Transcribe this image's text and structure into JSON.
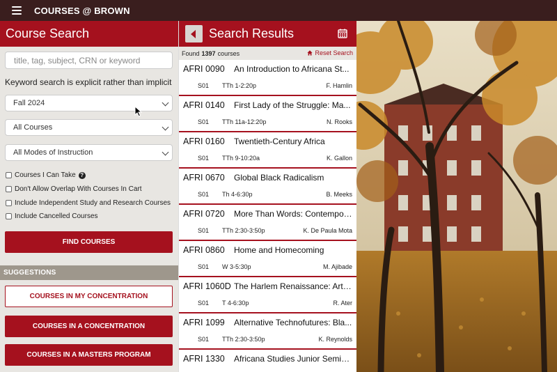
{
  "app": {
    "title": "COURSES @ BROWN"
  },
  "left": {
    "header": "Course Search",
    "search_placeholder": "title, tag, subject, CRN or keyword",
    "explicit_note": "Keyword search is explicit rather than implicit",
    "term": "Fall 2024",
    "course_filter": "All Courses",
    "mode_filter": "All Modes of Instruction",
    "checkboxes": [
      "Courses I Can Take",
      "Don't Allow Overlap With Courses In Cart",
      "Include Independent Study and Research Courses",
      "Include Cancelled Courses"
    ],
    "find_label": "FIND COURSES",
    "suggestions_header": "SUGGESTIONS",
    "suggestions": [
      "COURSES IN MY CONCENTRATION",
      "COURSES IN A CONCENTRATION",
      "COURSES IN A MASTERS PROGRAM"
    ]
  },
  "middle": {
    "header": "Search Results",
    "found_prefix": "Found",
    "found_count": "1397",
    "found_suffix": "courses",
    "reset_label": "Reset Search",
    "results": [
      {
        "code": "AFRI 0090",
        "title": "An Introduction to Africana St...",
        "section": "S01",
        "time": "TTh 1-2:20p",
        "instructor": "F. Hamlin"
      },
      {
        "code": "AFRI 0140",
        "title": "First Lady of the Struggle: Ma...",
        "section": "S01",
        "time": "TTh 11a-12:20p",
        "instructor": "N. Rooks"
      },
      {
        "code": "AFRI 0160",
        "title": "Twentieth-Century Africa",
        "section": "S01",
        "time": "TTh 9-10:20a",
        "instructor": "K. Gallon"
      },
      {
        "code": "AFRI 0670",
        "title": "Global Black Radicalism",
        "section": "S01",
        "time": "Th 4-6:30p",
        "instructor": "B. Meeks"
      },
      {
        "code": "AFRI 0720",
        "title": "More Than Words: Contempor...",
        "section": "S01",
        "time": "TTh 2:30-3:50p",
        "instructor": "K. De Paula Mota"
      },
      {
        "code": "AFRI 0860",
        "title": "Home and Homecoming",
        "section": "S01",
        "time": "W 3-5:30p",
        "instructor": "M. Ajibade"
      },
      {
        "code": "AFRI 1060D",
        "title": "The Harlem Renaissance: Art, ...",
        "section": "S01",
        "time": "T 4-6:30p",
        "instructor": "R. Ater"
      },
      {
        "code": "AFRI 1099",
        "title": "Alternative Technofutures: Bla...",
        "section": "S01",
        "time": "TTh 2:30-3:50p",
        "instructor": "K. Reynolds"
      },
      {
        "code": "AFRI 1330",
        "title": "Africana Studies Junior Seminar",
        "section": "",
        "time": "",
        "instructor": ""
      }
    ]
  },
  "icons": {
    "menu": "hamburger-icon",
    "back": "caret-left-icon",
    "calendar": "calendar-icon",
    "reset": "home-icon",
    "help": "question-circle-icon",
    "dropdown": "chevron-down-icon"
  },
  "colors": {
    "brand": "#a5111e",
    "topbar": "#3a1e1e",
    "panel": "#e8e6e2",
    "suggest": "#9e978c"
  }
}
